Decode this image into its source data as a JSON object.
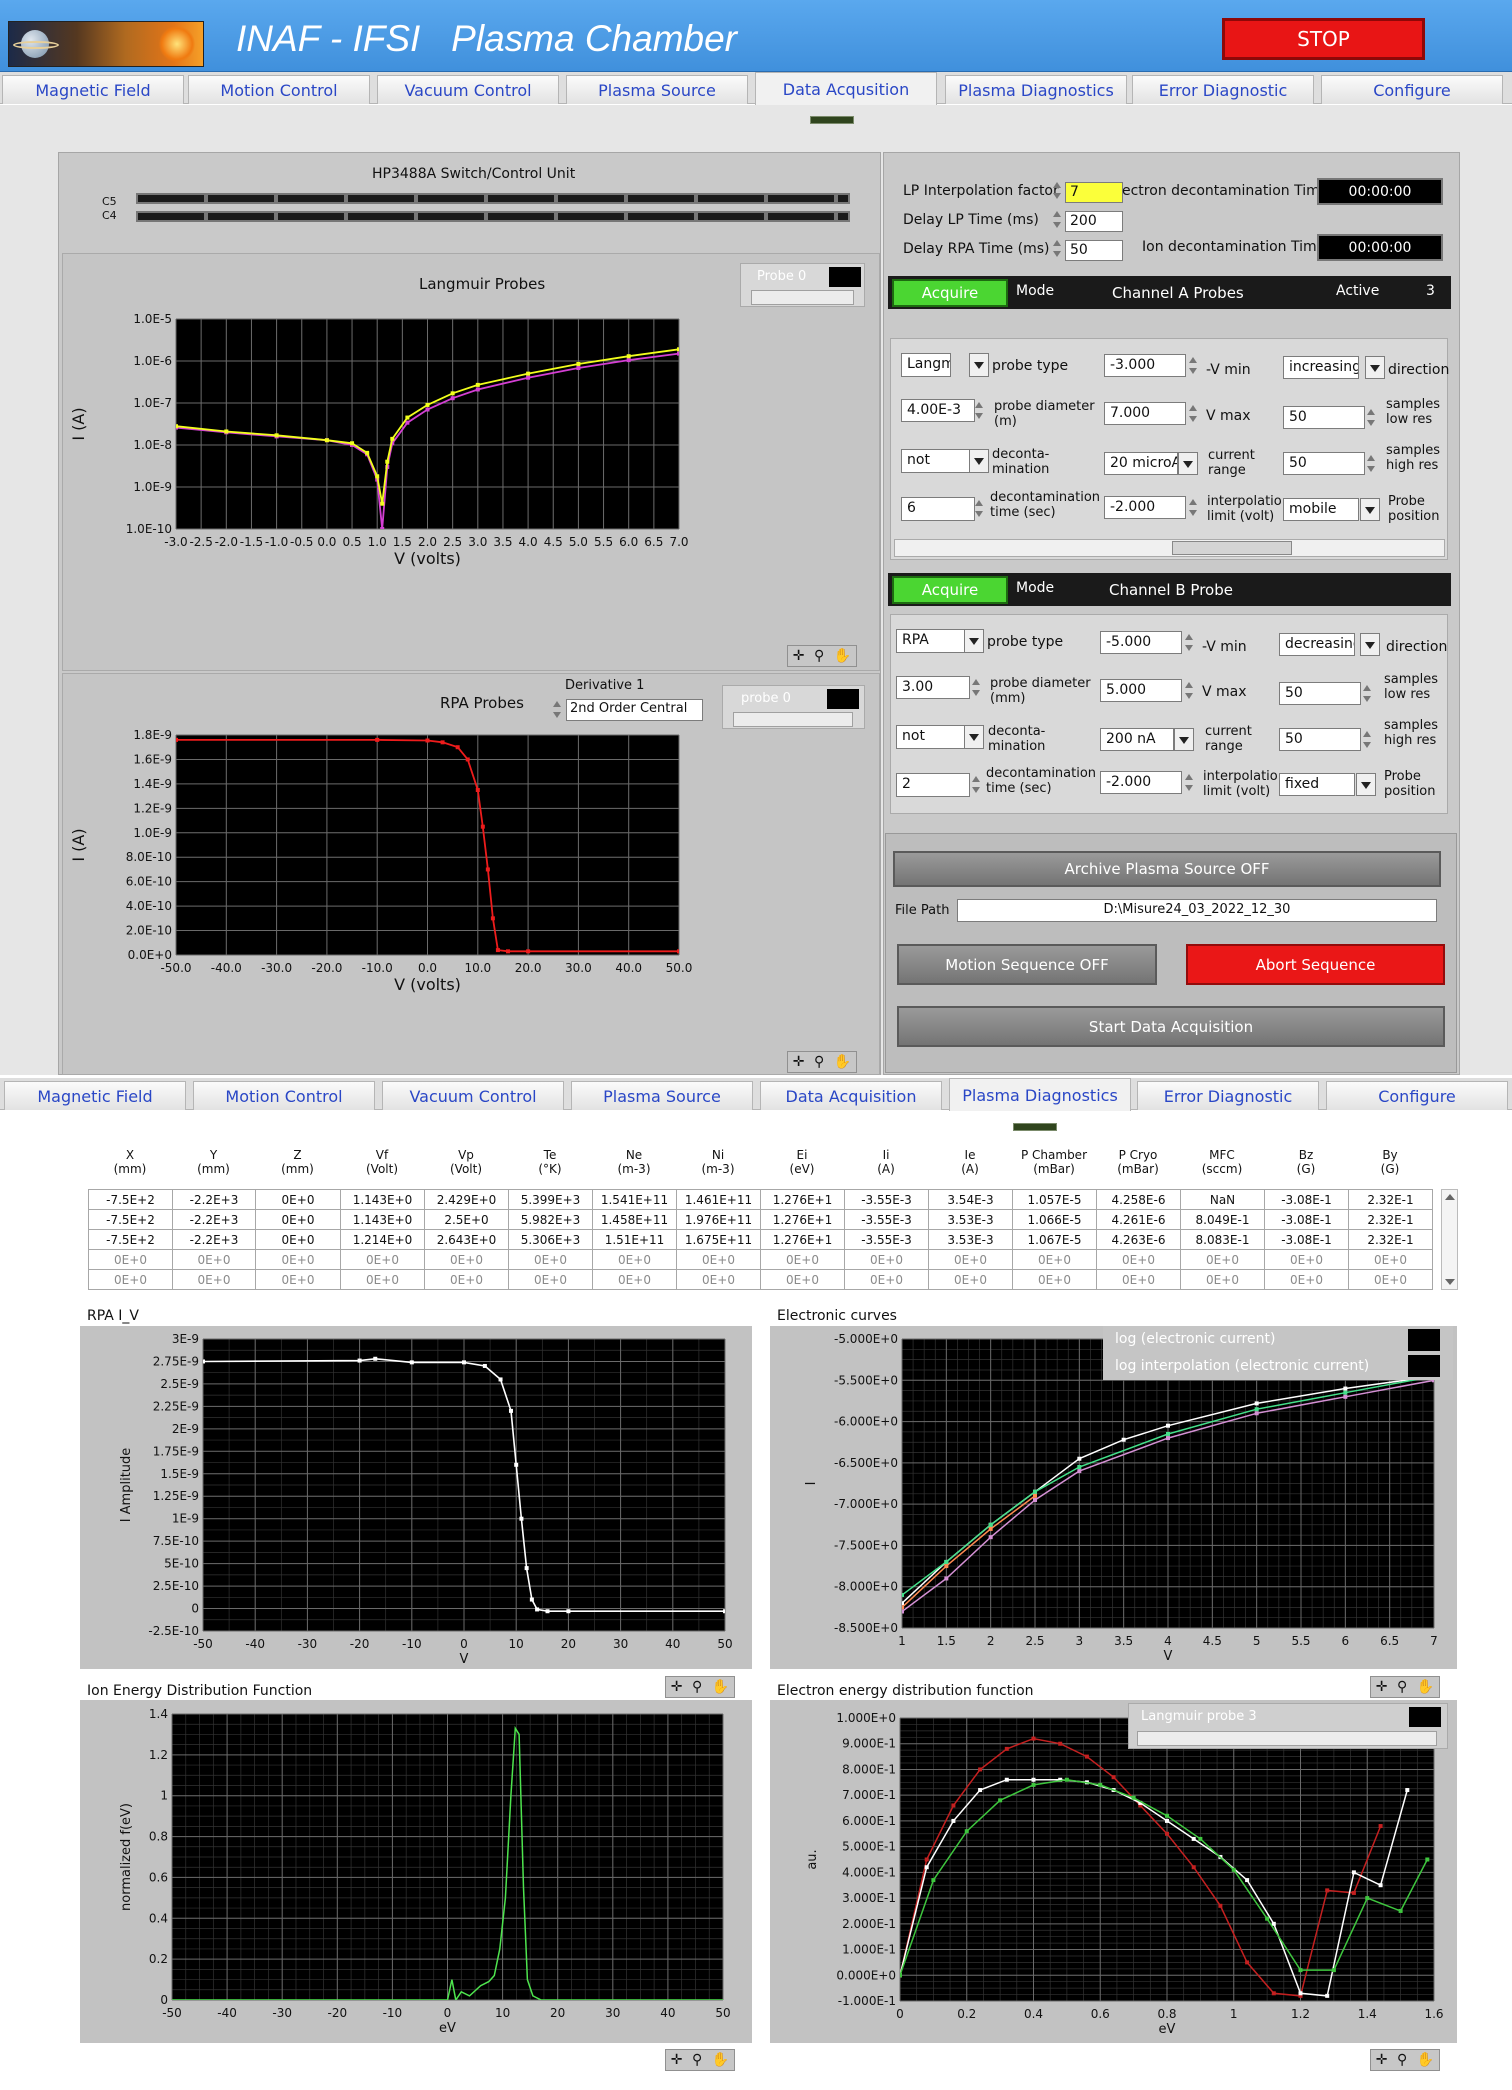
{
  "header": {
    "title": "INAF - IFSI   Plasma Chamber",
    "stop_label": "STOP"
  },
  "tabs": [
    "Magnetic Field",
    "Motion Control",
    "Vacuum Control",
    "Plasma Source",
    "Data Acquisition",
    "Plasma Diagnostics",
    "Error Diagnostic",
    "Configure"
  ],
  "tabs_top_active": "Data Acqusition",
  "switch_unit": {
    "title": "HP3488A Switch/Control Unit",
    "row1": "C5",
    "row2": "C4"
  },
  "settings": {
    "lp_interp_label": "LP Interpolation factor",
    "lp_interp_value": "7",
    "delay_lp_label": "Delay LP Time (ms)",
    "delay_lp_value": "200",
    "delay_rpa_label": "Delay RPA Time (ms)",
    "delay_rpa_value": "50",
    "e_decon_label": "ectron decontamination Time",
    "e_decon_value": "00:00:00",
    "i_decon_label": "Ion decontamination Time",
    "i_decon_value": "00:00:00"
  },
  "channel_a": {
    "acquire": "Acquire",
    "mode": "Mode",
    "name": "Channel A Probes",
    "active_label": "Active",
    "active_value": "3",
    "probe_type": "Langmui",
    "probe_type_label": "probe type",
    "vmin": "-3.000",
    "vmin_label": "-V min",
    "direction": "increasing",
    "direction_label": "direction",
    "diameter": "4.00E-3",
    "diameter_label": "probe diameter (m)",
    "vmax": "7.000",
    "vmax_label": "V max",
    "samples_low": "50",
    "samples_low_label": "samples low res",
    "decon": "not",
    "decon_label": "deconta- mination",
    "current": "20 microA",
    "current_label": "current range",
    "samples_high": "50",
    "samples_high_label": "samples high res",
    "decon_time": "6",
    "decon_time_label": "decontamination time (sec)",
    "interp": "-2.000",
    "interp_label": "interpolatio limit (volt)",
    "position": "mobile",
    "position_label": "Probe position"
  },
  "channel_b": {
    "acquire": "Acquire",
    "mode": "Mode",
    "name": "Channel B Probe",
    "probe_type": "RPA",
    "probe_type_label": "probe type",
    "vmin": "-5.000",
    "vmin_label": "-V min",
    "direction": "decreasing",
    "direction_label": "direction",
    "diameter": "3.00",
    "diameter_label": "probe diameter (mm)",
    "vmax": "5.000",
    "vmax_label": "V max",
    "samples_low": "50",
    "samples_low_label": "samples low res",
    "decon": "not",
    "decon_label": "deconta- mination",
    "current": "200 nA",
    "current_label": "current range",
    "samples_high": "50",
    "samples_high_label": "samples high res",
    "decon_time": "2",
    "decon_time_label": "decontamination time (sec)",
    "interp": "-2.000",
    "interp_label": "interpolatio limit (volt)",
    "position": "fixed",
    "position_label": "Probe position"
  },
  "controls": {
    "archive": "Archive Plasma Source OFF",
    "file_path_label": "File Path",
    "file_path": "D:\\Misure24_03_2022_12_30",
    "motion_seq": "Motion Sequence OFF",
    "abort": "Abort Sequence",
    "start": "Start Data Acquisition"
  },
  "langmuir_graph": {
    "title": "Langmuir Probes",
    "plot_label": "Probe 0"
  },
  "rpa_graph": {
    "title": "RPA Probes",
    "deriv_label": "Derivative 1",
    "deriv_value": "2nd Order Central",
    "plot_label": "probe 0"
  },
  "table": {
    "headers": [
      [
        "X",
        "(mm)"
      ],
      [
        "Y",
        "(mm)"
      ],
      [
        "Z",
        "(mm)"
      ],
      [
        "Vf",
        "(Volt)"
      ],
      [
        "Vp",
        "(Volt)"
      ],
      [
        "Te",
        "(°K)"
      ],
      [
        "Ne",
        "(m-3)"
      ],
      [
        "Ni",
        "(m-3)"
      ],
      [
        "Ei",
        "(eV)"
      ],
      [
        "Ii",
        "(A)"
      ],
      [
        "Ie",
        "(A)"
      ],
      [
        "P Chamber",
        "(mBar)"
      ],
      [
        "P Cryo",
        "(mBar)"
      ],
      [
        "MFC",
        "(sccm)"
      ],
      [
        "Bz",
        "(G)"
      ],
      [
        "By",
        "(G)"
      ]
    ],
    "rows": [
      [
        "-7.5E+2",
        "-2.2E+3",
        "0E+0",
        "1.143E+0",
        "2.429E+0",
        "5.399E+3",
        "1.541E+11",
        "1.461E+11",
        "1.276E+1",
        "-3.55E-3",
        "3.54E-3",
        "1.057E-5",
        "4.258E-6",
        "NaN",
        "-3.08E-1",
        "2.32E-1"
      ],
      [
        "-7.5E+2",
        "-2.2E+3",
        "0E+0",
        "1.143E+0",
        "2.5E+0",
        "5.982E+3",
        "1.458E+11",
        "1.976E+11",
        "1.276E+1",
        "-3.55E-3",
        "3.53E-3",
        "1.066E-5",
        "4.261E-6",
        "8.049E-1",
        "-3.08E-1",
        "2.32E-1"
      ],
      [
        "-7.5E+2",
        "-2.2E+3",
        "0E+0",
        "1.214E+0",
        "2.643E+0",
        "5.306E+3",
        "1.51E+11",
        "1.675E+11",
        "1.276E+1",
        "-3.55E-3",
        "3.53E-3",
        "1.067E-5",
        "4.263E-6",
        "8.083E-1",
        "-3.08E-1",
        "2.32E-1"
      ],
      [
        "0E+0",
        "0E+0",
        "0E+0",
        "0E+0",
        "0E+0",
        "0E+0",
        "0E+0",
        "0E+0",
        "0E+0",
        "0E+0",
        "0E+0",
        "0E+0",
        "0E+0",
        "0E+0",
        "0E+0",
        "0E+0"
      ],
      [
        "0E+0",
        "0E+0",
        "0E+0",
        "0E+0",
        "0E+0",
        "0E+0",
        "0E+0",
        "0E+0",
        "0E+0",
        "0E+0",
        "0E+0",
        "0E+0",
        "0E+0",
        "0E+0",
        "0E+0",
        "0E+0"
      ]
    ]
  },
  "legend": {
    "item1": "log (electronic current)",
    "item2": "log interpolation (electronic current)",
    "eedf_plot": "Langmuir probe 3"
  },
  "chart_data": [
    {
      "id": "langmuir",
      "type": "line",
      "title": "Langmuir Probes",
      "xlabel": "V (volts)",
      "ylabel": "I (A)",
      "xlim": [
        -3,
        7
      ],
      "ylim": [
        1e-10,
        1e-05
      ],
      "yscale": "log",
      "xticks": [
        "-3.0",
        "-2.5",
        "-2.0",
        "-1.5",
        "-1.0",
        "-0.5",
        "0.0",
        "0.5",
        "1.0",
        "1.5",
        "2.0",
        "2.5",
        "3.0",
        "3.5",
        "4.0",
        "4.5",
        "5.0",
        "5.5",
        "6.0",
        "6.5",
        "7.0"
      ],
      "yticks": [
        "1.0E-10",
        "1.0E-9",
        "1.0E-8",
        "1.0E-7",
        "1.0E-6",
        "1.0E-5"
      ],
      "series": [
        {
          "color": "#d43fd4",
          "x": [
            -3,
            -2,
            -1,
            0,
            0.5,
            0.8,
            1.0,
            1.1,
            1.2,
            1.3,
            1.6,
            2,
            2.5,
            3,
            4,
            5,
            6,
            7
          ],
          "y": [
            2.6e-08,
            2e-08,
            1.6e-08,
            1.3e-08,
            1e-08,
            6e-09,
            1.5e-09,
            1e-10,
            3e-09,
            1.1e-08,
            3.4e-08,
            7e-08,
            1.3e-07,
            2.1e-07,
            4e-07,
            6.8e-07,
            1.05e-06,
            1.5e-06
          ]
        },
        {
          "color": "#f2ff1c",
          "x": [
            -3,
            -2,
            -1,
            0,
            0.5,
            0.8,
            1.0,
            1.1,
            1.2,
            1.3,
            1.6,
            2,
            2.5,
            3,
            4,
            5,
            6,
            7
          ],
          "y": [
            2.8e-08,
            2.1e-08,
            1.7e-08,
            1.3e-08,
            1.1e-08,
            6.5e-09,
            1.8e-09,
            4e-10,
            4e-09,
            1.4e-08,
            4.5e-08,
            9e-08,
            1.7e-07,
            2.7e-07,
            5e-07,
            8.5e-07,
            1.3e-06,
            1.9e-06
          ]
        }
      ]
    },
    {
      "id": "rpa",
      "type": "line",
      "title": "RPA Probes",
      "xlabel": "V (volts)",
      "ylabel": "I (A)",
      "xlim": [
        -50,
        50
      ],
      "ylim": [
        0,
        1.8e-09
      ],
      "xticks": [
        "-50.0",
        "-40.0",
        "-30.0",
        "-20.0",
        "-10.0",
        "0.0",
        "10.0",
        "20.0",
        "30.0",
        "40.0",
        "50.0"
      ],
      "yticks": [
        "0.0E+0",
        "2.0E-10",
        "4.0E-10",
        "6.0E-10",
        "8.0E-10",
        "1.0E-9",
        "1.2E-9",
        "1.4E-9",
        "1.6E-9",
        "1.8E-9"
      ],
      "series": [
        {
          "color": "#ee1c1c",
          "x": [
            -50,
            -10,
            0,
            3,
            6,
            8,
            10,
            11,
            12,
            13,
            14,
            16,
            20,
            50
          ],
          "y": [
            1.76e-09,
            1.76e-09,
            1.755e-09,
            1.74e-09,
            1.7e-09,
            1.6e-09,
            1.35e-09,
            1.05e-09,
            7e-10,
            3e-10,
            4e-11,
            3e-11,
            3e-11,
            3e-11
          ]
        }
      ]
    },
    {
      "id": "rpa_iv",
      "type": "line",
      "title": "RPA I_V",
      "xlabel": "V",
      "ylabel": "I Amplitude",
      "xlim": [
        -50,
        50
      ],
      "ylim": [
        -2.5e-10,
        3e-09
      ],
      "xticks": [
        "-50",
        "-40",
        "-30",
        "-20",
        "-10",
        "0",
        "10",
        "20",
        "30",
        "40",
        "50"
      ],
      "yticks": [
        "-2.5E-10",
        "0",
        "2.5E-10",
        "5E-10",
        "7.5E-10",
        "1E-9",
        "1.25E-9",
        "1.5E-9",
        "1.75E-9",
        "2E-9",
        "2.25E-9",
        "2.5E-9",
        "2.75E-9",
        "3E-9"
      ],
      "series": [
        {
          "color": "#ffffff",
          "x": [
            -50,
            -20,
            -17,
            -10,
            0,
            4,
            7,
            9,
            10,
            11,
            12,
            13,
            14,
            16,
            20,
            50
          ],
          "y": [
            2.75e-09,
            2.76e-09,
            2.78e-09,
            2.74e-09,
            2.74e-09,
            2.7e-09,
            2.55e-09,
            2.2e-09,
            1.6e-09,
            1e-09,
            4.5e-10,
            1e-10,
            -1e-11,
            -3e-11,
            -3e-11,
            -3e-11
          ]
        }
      ]
    },
    {
      "id": "electronic",
      "type": "line",
      "title": "Electronic curves",
      "xlabel": "V",
      "ylabel": "I",
      "xlim": [
        1,
        7
      ],
      "ylim": [
        -8.5,
        -5
      ],
      "xticks": [
        "1",
        "1.5",
        "2",
        "2.5",
        "3",
        "3.5",
        "4",
        "4.5",
        "5",
        "5.5",
        "6",
        "6.5",
        "7"
      ],
      "yticks": [
        "-8.500E+0",
        "-8.000E+0",
        "-7.500E+0",
        "-7.000E+0",
        "-6.500E+0",
        "-6.000E+0",
        "-5.500E+0",
        "-5.000E+0"
      ],
      "series": [
        {
          "name": "log (electronic current)",
          "color": "#ffffff",
          "x": [
            1,
            1.5,
            2,
            2.5,
            3,
            3.5,
            4,
            5,
            6,
            7
          ],
          "y": [
            -8.2,
            -7.7,
            -7.25,
            -6.85,
            -6.45,
            -6.22,
            -6.05,
            -5.78,
            -5.6,
            -5.45
          ]
        },
        {
          "name": "log interpolation (electronic current)",
          "color": "#ff8a50",
          "x": [
            1,
            1.5,
            2,
            2.5
          ],
          "y": [
            -8.25,
            -7.75,
            -7.3,
            -6.9
          ]
        },
        {
          "color": "#44e08a",
          "x": [
            1,
            1.5,
            2,
            2.5,
            3,
            4,
            5,
            6,
            7
          ],
          "y": [
            -8.1,
            -7.7,
            -7.25,
            -6.85,
            -6.55,
            -6.15,
            -5.85,
            -5.65,
            -5.45
          ]
        },
        {
          "color": "#d490d4",
          "x": [
            1,
            1.5,
            2,
            2.5,
            3,
            4,
            5,
            6,
            7
          ],
          "y": [
            -8.3,
            -7.9,
            -7.4,
            -6.95,
            -6.6,
            -6.2,
            -5.9,
            -5.7,
            -5.5
          ]
        }
      ]
    },
    {
      "id": "iedf",
      "type": "line",
      "title": "Ion Energy Distribution Function",
      "xlabel": "eV",
      "ylabel": "normalized f(eV)",
      "xlim": [
        -50,
        50
      ],
      "ylim": [
        0,
        1.4
      ],
      "xticks": [
        "-50",
        "-40",
        "-30",
        "-20",
        "-10",
        "0",
        "10",
        "20",
        "30",
        "40",
        "50"
      ],
      "yticks": [
        "0",
        "0.2",
        "0.4",
        "0.6",
        "0.8",
        "1",
        "1.2",
        "1.4"
      ],
      "series": [
        {
          "color": "#4ee44e",
          "x": [
            -50,
            0,
            0.8,
            1.5,
            2.5,
            4,
            6,
            7.5,
            8.5,
            9.5,
            10.5,
            11.5,
            12.3,
            13,
            13.8,
            14.5,
            15.5,
            17,
            50
          ],
          "y": [
            0,
            0,
            0.1,
            0,
            0.04,
            0.02,
            0.07,
            0.09,
            0.12,
            0.25,
            0.5,
            1.0,
            1.33,
            1.3,
            0.55,
            0.1,
            0.02,
            0,
            0
          ]
        }
      ]
    },
    {
      "id": "eedf",
      "type": "line",
      "title": "Electron energy distribution function",
      "xlabel": "eV",
      "ylabel": "au.",
      "xlim": [
        0,
        1.6
      ],
      "ylim": [
        -0.1,
        1.0
      ],
      "xticks": [
        "0",
        "0.2",
        "0.4",
        "0.6",
        "0.8",
        "1",
        "1.2",
        "1.4",
        "1.6"
      ],
      "yticks": [
        "-1.000E-1",
        "0.000E+0",
        "1.000E-1",
        "2.000E-1",
        "3.000E-1",
        "4.000E-1",
        "5.000E-1",
        "6.000E-1",
        "7.000E-1",
        "8.000E-1",
        "9.000E-1",
        "1.000E+0"
      ],
      "series": [
        {
          "color": "#c42020",
          "x": [
            0,
            0.08,
            0.16,
            0.24,
            0.32,
            0.4,
            0.48,
            0.56,
            0.64,
            0.72,
            0.8,
            0.88,
            0.96,
            1.04,
            1.12,
            1.2,
            1.28,
            1.36,
            1.44
          ],
          "y": [
            0,
            0.45,
            0.66,
            0.8,
            0.88,
            0.92,
            0.9,
            0.85,
            0.77,
            0.66,
            0.55,
            0.42,
            0.27,
            0.05,
            -0.07,
            -0.08,
            0.33,
            0.32,
            0.58
          ]
        },
        {
          "color": "#ffffff",
          "x": [
            0,
            0.08,
            0.16,
            0.24,
            0.32,
            0.4,
            0.48,
            0.56,
            0.64,
            0.72,
            0.8,
            0.88,
            0.96,
            1.04,
            1.12,
            1.2,
            1.28,
            1.36,
            1.44,
            1.52
          ],
          "y": [
            0,
            0.42,
            0.6,
            0.72,
            0.76,
            0.76,
            0.76,
            0.75,
            0.72,
            0.67,
            0.6,
            0.53,
            0.46,
            0.37,
            0.2,
            -0.07,
            -0.08,
            0.4,
            0.35,
            0.72
          ]
        },
        {
          "color": "#3ec63e",
          "x": [
            0,
            0.1,
            0.2,
            0.3,
            0.4,
            0.5,
            0.6,
            0.7,
            0.8,
            0.9,
            1.0,
            1.1,
            1.2,
            1.3,
            1.4,
            1.5,
            1.58
          ],
          "y": [
            0,
            0.37,
            0.56,
            0.68,
            0.74,
            0.76,
            0.74,
            0.69,
            0.62,
            0.53,
            0.41,
            0.22,
            0.02,
            0.02,
            0.3,
            0.25,
            0.45
          ]
        }
      ]
    }
  ]
}
